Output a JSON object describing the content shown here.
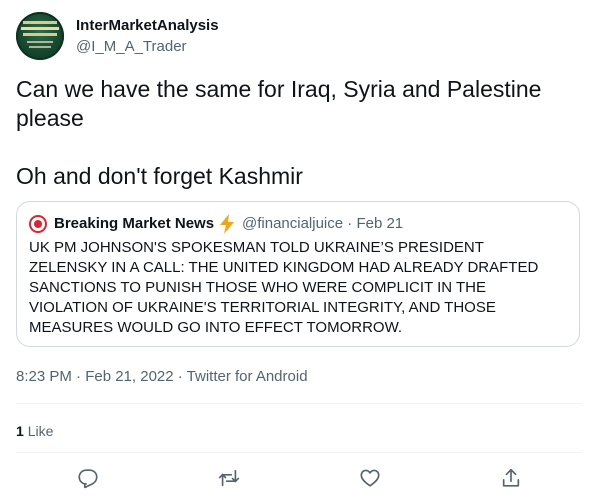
{
  "author": {
    "name": "InterMarketAnalysis",
    "handle": "@I_M_A_Trader",
    "avatar_text": "INTERMARKET TECHNICAL ANALYSIS"
  },
  "tweet": {
    "text_line1": "Can we have the same for Iraq, Syria and Palestine please",
    "text_line2": "Oh and don't forget Kashmir"
  },
  "quoted": {
    "name": "Breaking Market News",
    "emoji": "lightning-bolt",
    "handle_and_date": "@financialjuice · Feb 21",
    "text": "UK PM JOHNSON'S SPOKESMAN TOLD UKRAINE’S PRESIDENT ZELENSKY IN A CALL: THE UNITED KINGDOM HAD ALREADY DRAFTED SANCTIONS TO PUNISH THOSE WHO WERE COMPLICIT IN THE VIOLATION OF UKRAINE'S TERRITORIAL INTEGRITY, AND THOSE MEASURES WOULD GO INTO EFFECT TOMORROW."
  },
  "meta": {
    "timestamp": "8:23 PM · Feb 21, 2022 · Twitter for Android"
  },
  "stats": {
    "likes_count": "1",
    "likes_label": "Like"
  },
  "actions": [
    {
      "name": "reply",
      "icon": "reply-icon"
    },
    {
      "name": "retweet",
      "icon": "retweet-icon"
    },
    {
      "name": "like",
      "icon": "heart-icon"
    },
    {
      "name": "share",
      "icon": "share-icon"
    }
  ],
  "colors": {
    "text": "#0f1419",
    "secondary": "#536471",
    "border": "#cfd9de",
    "news_red": "#e0242e",
    "bolt": "#f4a419"
  }
}
